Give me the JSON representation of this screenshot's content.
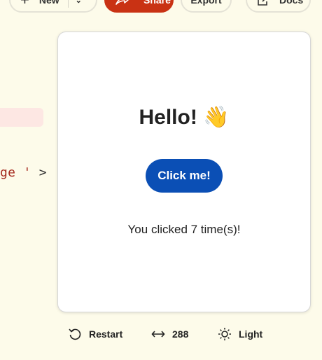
{
  "toolbar": {
    "new_label": "New",
    "share_label": "Share",
    "export_label": "Export",
    "docs_label": "Docs"
  },
  "editor": {
    "code_string": "ge '",
    "code_tag_end": " >"
  },
  "preview": {
    "heading": "Hello! 👋",
    "button_label": "Click me!",
    "count_text": "You clicked 7 time(s)!"
  },
  "footer": {
    "restart_label": "Restart",
    "width_value": "288",
    "theme_label": "Light"
  },
  "colors": {
    "accent": "#c93214",
    "button_blue": "#0b4fb5",
    "background": "#fdfbea"
  },
  "icons": {
    "new": "plus-icon",
    "dropdown": "chevron-down-icon",
    "share": "share-icon",
    "docs": "external-link-icon",
    "restart": "restart-icon",
    "width": "resize-horizontal-icon",
    "theme": "sun-icon"
  }
}
